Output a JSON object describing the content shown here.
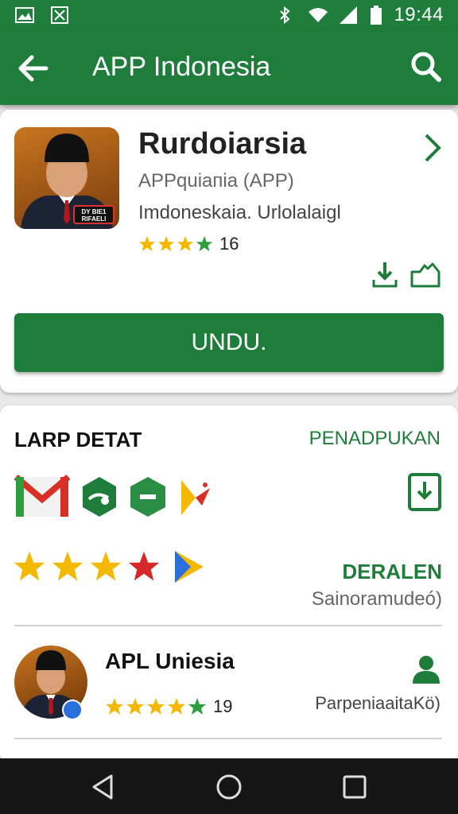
{
  "status_bar": {
    "time": "19:44",
    "icons": [
      "image-icon",
      "gallery-icon",
      "bluetooth-icon",
      "wifi-icon",
      "signal-icon",
      "battery-icon"
    ]
  },
  "app_bar": {
    "title": "APP Indonesia",
    "back_icon": "arrow-left-icon",
    "search_icon": "search-icon"
  },
  "app_card": {
    "name": "Rurdoiarsia",
    "subtitle": "APPquiaпia (APP)",
    "developer": "Imdoneskaia. Urlolalaigl",
    "rating_value": 4,
    "rating_count": "16",
    "badge_text": "DY BIE1 RIFAELI",
    "install_label": "UNDU."
  },
  "detail_card": {
    "section_title": "LARP DETAT",
    "section_link": "PENADPUKAN",
    "icons": [
      "gmail-icon",
      "green-app-icon",
      "green-hex-icon",
      "pinwheel-icon"
    ],
    "big_stars_filled": 4,
    "rank_label": "DERALEN",
    "rank_sub": "Sainoramudeó)",
    "user": {
      "name": "APL Uniesia",
      "rating_value": 5,
      "rating_count": "19",
      "meta": "ParpeniaaitaKö)"
    }
  },
  "colors": {
    "primary": "#1e7d3b",
    "star": "#f5b800",
    "star_green": "#2e9e3f",
    "star_red": "#d62828"
  }
}
